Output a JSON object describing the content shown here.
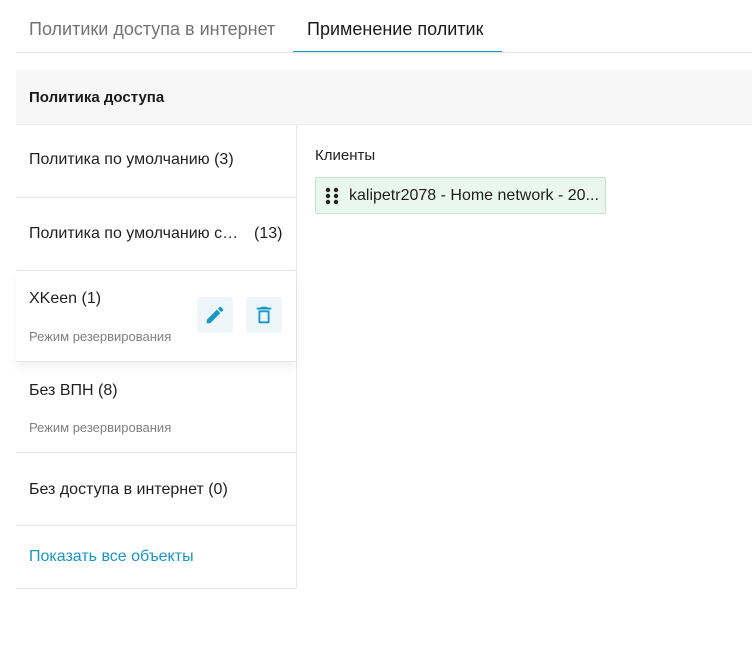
{
  "tabs": [
    {
      "label": "Политики доступа в интернет",
      "active": false
    },
    {
      "label": "Применение политик",
      "active": true
    }
  ],
  "header": {
    "title": "Политика доступа"
  },
  "policies": [
    {
      "name": "Политика по умолчанию (3)"
    },
    {
      "name": "Политика по умолчанию се...",
      "count": "(13)"
    },
    {
      "name": "XKeen (1)",
      "subtitle": "Режим резервирования",
      "active": true
    },
    {
      "name": "Без ВПН (8)",
      "subtitle": "Режим резервирования"
    },
    {
      "name": "Без доступа в интернет (0)"
    }
  ],
  "show_all": "Показать все объекты",
  "clients": {
    "label": "Клиенты",
    "items": [
      {
        "text": "kalipetr2078 - Home network - 20..."
      }
    ]
  },
  "icons": {
    "edit": "pencil-icon",
    "delete": "trash-icon",
    "drag": "drag-handle-icon"
  },
  "colors": {
    "accent": "#1797c7",
    "chip_bg": "#e9f7ee",
    "chip_border": "#bfe6cc"
  }
}
